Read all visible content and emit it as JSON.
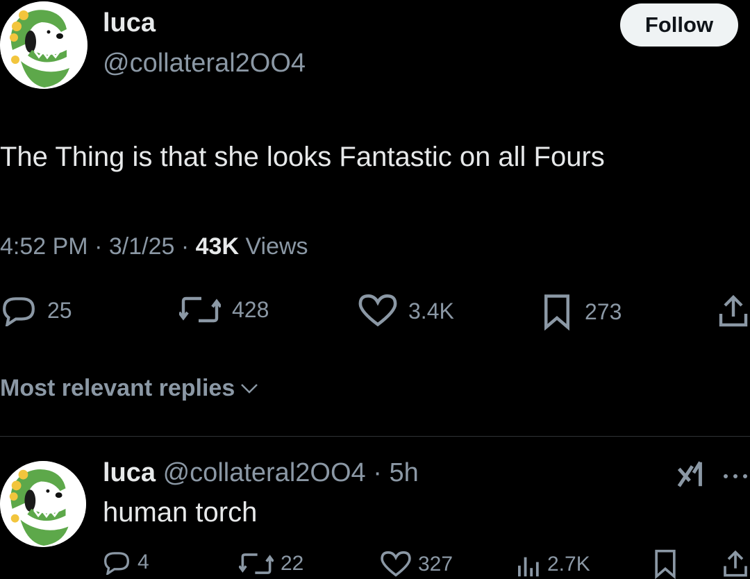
{
  "tweet": {
    "author_name": "luca",
    "author_handle": "@collateral2OO4",
    "follow_label": "Follow",
    "text": "The Thing is that she looks Fantastic on all Fours",
    "time": "4:52 PM",
    "date": "3/1/25",
    "views_count": "43K",
    "views_label": "Views",
    "sep": "·",
    "stats": {
      "replies": "25",
      "reposts": "428",
      "likes": "3.4K",
      "bookmarks": "273"
    }
  },
  "replies_sort": {
    "label": "Most relevant replies"
  },
  "reply": {
    "author_name": "luca",
    "author_handle": "@collateral2OO4",
    "sep": "·",
    "age": "5h",
    "text": "human torch",
    "stats": {
      "replies": "4",
      "reposts": "22",
      "likes": "327",
      "views": "2.7K"
    }
  },
  "icons": {
    "reply": "reply-icon",
    "repost": "repost-icon",
    "like": "heart-icon",
    "bookmark": "bookmark-icon",
    "share": "share-icon",
    "views": "views-icon",
    "grok": "grok-icon",
    "more": "more-icon",
    "chevron": "chevron-down-icon"
  },
  "colors": {
    "background": "#000000",
    "text": "#e7e9ea",
    "muted": "#8b98a5",
    "follow_bg": "#eff3f4",
    "divider": "#2f3336"
  }
}
